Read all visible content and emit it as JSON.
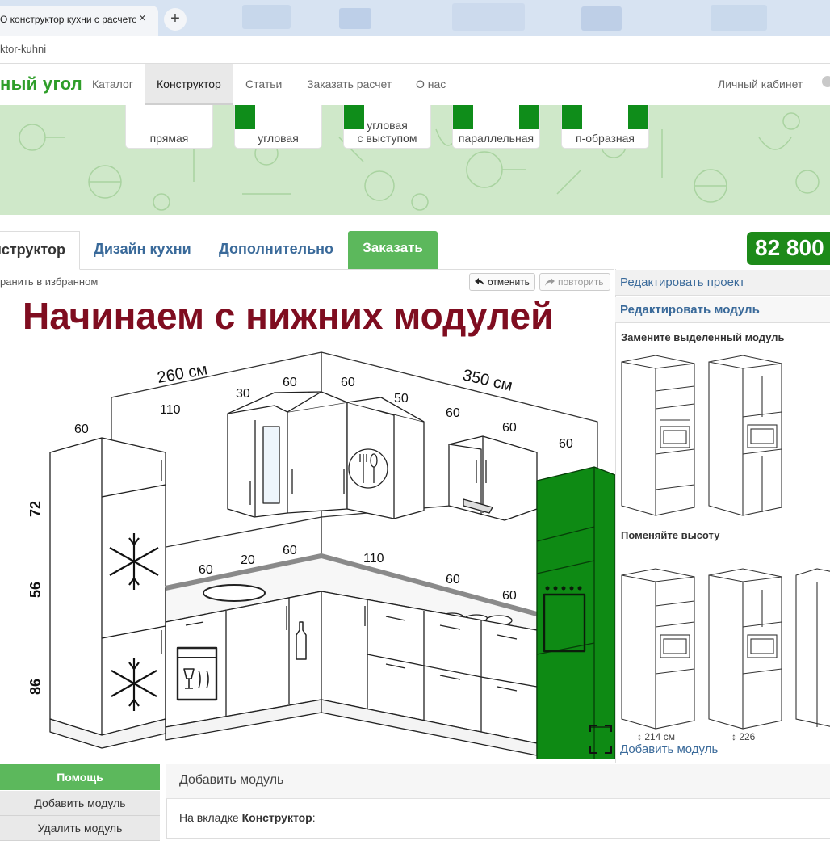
{
  "browser": {
    "tab_title": "О конструктор кухни с расчетом",
    "tab_close": "×",
    "new_tab": "+",
    "url": "ktor-kuhni"
  },
  "site": {
    "logo": "ный угол",
    "nav": [
      "Каталог",
      "Конструктор",
      "Статьи",
      "Заказать расчет",
      "О нас"
    ],
    "active_nav": "Конструктор",
    "cabinet": "Личный кабинет",
    "accent": "#2f9e2a"
  },
  "shapes": [
    {
      "line1": "",
      "line2": "прямая"
    },
    {
      "line1": "",
      "line2": "угловая"
    },
    {
      "line1": "угловая",
      "line2": "с выступом"
    },
    {
      "line1": "",
      "line2": "параллельная"
    },
    {
      "line1": "",
      "line2": "п-образная"
    }
  ],
  "tabs": {
    "constructor": "Конструктор",
    "design": "Дизайн кухни",
    "extra": "Дополнительно",
    "order": "Заказать"
  },
  "price": "82 800",
  "toolbar": {
    "save_fav": "ранить в избранном",
    "undo": "отменить",
    "redo": "повторить"
  },
  "headline": "Начинаем с нижних модулей",
  "kitchen": {
    "wall_widths": [
      "260 см",
      "350 см"
    ],
    "heights": [
      "72",
      "56",
      "86"
    ],
    "dims": [
      "60",
      "110",
      "30",
      "60",
      "60",
      "50",
      "60",
      "60",
      "60",
      "60",
      "20",
      "60",
      "110",
      "60",
      "60"
    ],
    "highlight_color": "#0e8a14"
  },
  "right_panel": {
    "edit_project": "Редактировать проект",
    "edit_module": "Редактировать модуль",
    "replace_selected": "Замените выделенный модуль",
    "change_height": "Поменяйте высоту",
    "height_options": [
      "↕ 214 см",
      "↕ 226",
      ""
    ],
    "add_module": "Добавить модуль"
  },
  "help": {
    "title": "Помощь",
    "items": [
      "Добавить модуль",
      "Удалить модуль"
    ]
  },
  "content": {
    "title": "Добавить модуль",
    "text_prefix": "На вкладке ",
    "text_bold": "Конструктор",
    "text_suffix": ":"
  }
}
